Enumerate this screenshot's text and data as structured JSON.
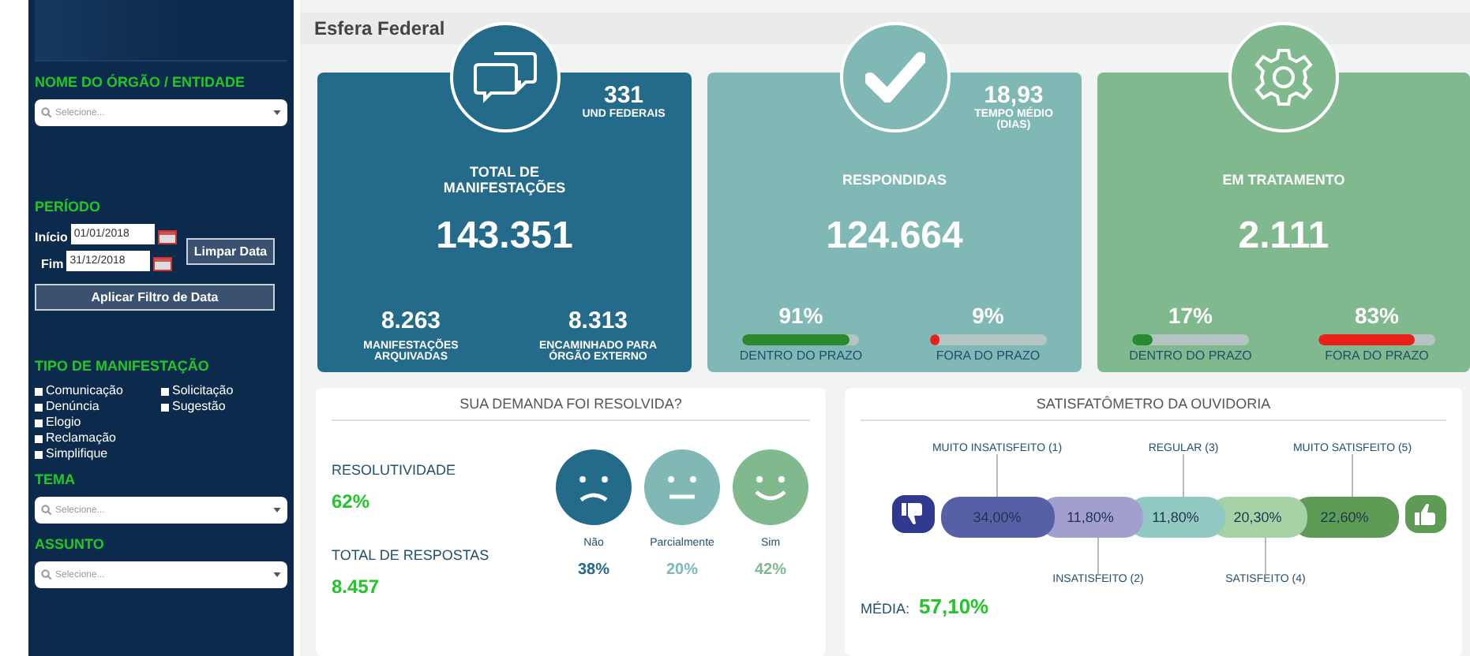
{
  "sidebar": {
    "sections": [
      {
        "kind": "select",
        "title": "NOME DO ÓRGÃO / ENTIDADE",
        "placeholder": "Selecione..."
      },
      {
        "kind": "period",
        "title": "PERÍODO",
        "start_label": "Início",
        "start_value": "01/01/2018",
        "end_label": "Fim",
        "end_value": "31/12/2018",
        "clear_button": "Limpar Data",
        "apply_button": "Aplicar Filtro de Data"
      },
      {
        "kind": "checks",
        "title": "TIPO DE MANIFESTAÇÃO",
        "options": [
          {
            "label": "Comunicação",
            "checked": false
          },
          {
            "label": "Denúncia",
            "checked": false
          },
          {
            "label": "Elogio",
            "checked": false
          },
          {
            "label": "Reclamação",
            "checked": false
          },
          {
            "label": "Simplifique",
            "checked": false
          },
          {
            "label": "Solicitação",
            "checked": false
          },
          {
            "label": "Sugestão",
            "checked": false
          }
        ]
      },
      {
        "kind": "select",
        "title": "TEMA",
        "placeholder": "Selecione..."
      },
      {
        "kind": "select",
        "title": "ASSUNTO",
        "placeholder": "Selecione..."
      }
    ]
  },
  "header": {
    "title": "Esfera Federal"
  },
  "cards": [
    {
      "kind": "chat",
      "color": "#246a8a",
      "title": "TOTAL DE MANIFESTAÇÕES",
      "value": "143.351",
      "corner": {
        "value": "331",
        "label": "UND FEDERAIS"
      },
      "stats": [
        {
          "value": "8.263",
          "label": "MANIFESTAÇÕES ARQUIVADAS"
        },
        {
          "value": "8.313",
          "label": "ENCAMINHADO PARA ÓRGÃO EXTERNO"
        }
      ]
    },
    {
      "kind": "check",
      "color": "#7fb8b4",
      "title": "RESPONDIDAS",
      "value": "124.664",
      "corner": {
        "value": "18,93",
        "label": "TEMPO MÉDIO (DIAS)"
      },
      "bars": [
        {
          "kind": "on_time",
          "reading": "91%",
          "level": 0.91,
          "label": "DENTRO DO PRAZO"
        },
        {
          "kind": "late",
          "reading": "9%",
          "level": 0.09,
          "label": "FORA DO PRAZO"
        }
      ]
    },
    {
      "kind": "gear",
      "color": "#7fb98d",
      "title": "EM TRATAMENTO",
      "value": "2.111",
      "bars": [
        {
          "kind": "on_time",
          "reading": "17%",
          "level": 0.17,
          "label": "DENTRO DO PRAZO"
        },
        {
          "kind": "late",
          "reading": "83%",
          "level": 0.83,
          "label": "FORA DO PRAZO"
        }
      ]
    }
  ],
  "resolved_panel": {
    "title": "SUA DEMANDA FOI RESOLVIDA?",
    "metrics": [
      {
        "label": "RESOLUTIVIDADE",
        "value": "62%"
      },
      {
        "label": "TOTAL DE RESPOSTAS",
        "value": "8.457"
      }
    ],
    "faces": [
      {
        "kind": "sad",
        "color": "#246a8a",
        "label": "Não",
        "value": "38%"
      },
      {
        "kind": "neutral",
        "color": "#7fb8b4",
        "label": "Parcialmente",
        "value": "20%"
      },
      {
        "kind": "happy",
        "color": "#7fb98d",
        "label": "Sim",
        "value": "42%"
      }
    ]
  },
  "satisfaction_panel": {
    "title": "SATISFATÔMETRO DA OUVIDORIA",
    "segments": [
      {
        "value": "34,00%",
        "label": "MUITO INSATISFEITO (1)",
        "kind": "above",
        "color": "#5660a6"
      },
      {
        "value": "11,80%",
        "label": "INSATISFEITO (2)",
        "kind": "below",
        "color": "#a29fcf"
      },
      {
        "value": "11,80%",
        "label": "REGULAR (3)",
        "kind": "above",
        "color": "#92c9c3"
      },
      {
        "value": "20,30%",
        "label": "SATISFEITO (4)",
        "kind": "below",
        "color": "#a6d2a6"
      },
      {
        "value": "22,60%",
        "label": "MUITO SATISFEITO (5)",
        "kind": "above",
        "color": "#5e9c55"
      }
    ],
    "average_label": "MÉDIA:",
    "average_value": "57,10%"
  }
}
